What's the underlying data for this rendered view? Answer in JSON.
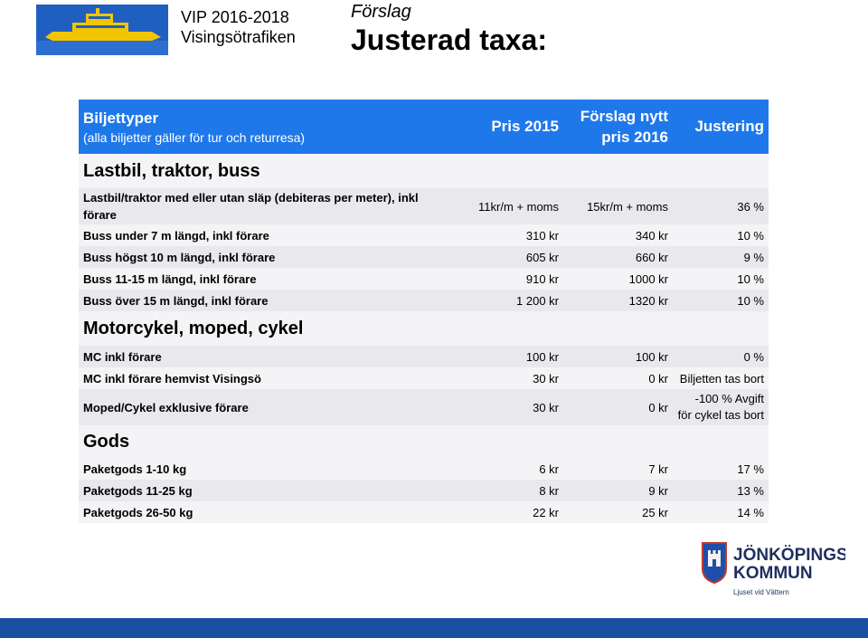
{
  "header": {
    "org_line1": "VIP 2016-2018",
    "org_line2": "Visingsötrafiken",
    "subtitle": "Förslag",
    "title": "Justerad taxa:"
  },
  "table": {
    "head": {
      "col1_title": "Biljettyper",
      "col1_sub": "(alla biljetter gäller för tur och returresa)",
      "col2": "Pris 2015",
      "col3_line1": "Förslag nytt",
      "col3_line2": "pris 2016",
      "col4": "Justering"
    },
    "sections": [
      {
        "title": "Lastbil, traktor, buss",
        "rows": [
          {
            "name": "Lastbil/traktor med eller utan släp (debiteras per meter), inkl förare",
            "p15": "11kr/m + moms",
            "p16": "15kr/m + moms",
            "adj": "36 %"
          },
          {
            "name": "Buss under 7 m längd, inkl förare",
            "p15": "310 kr",
            "p16": "340 kr",
            "adj": "10 %"
          },
          {
            "name": "Buss högst 10 m längd, inkl förare",
            "p15": "605 kr",
            "p16": "660 kr",
            "adj": "9 %"
          },
          {
            "name": "Buss 11-15 m längd, inkl förare",
            "p15": "910 kr",
            "p16": "1000 kr",
            "adj": "10 %"
          },
          {
            "name": "Buss över 15 m längd, inkl förare",
            "p15": "1 200 kr",
            "p16": "1320 kr",
            "adj": "10 %"
          }
        ]
      },
      {
        "title": "Motorcykel, moped, cykel",
        "rows": [
          {
            "name": "MC inkl förare",
            "p15": "100 kr",
            "p16": "100 kr",
            "adj": "0 %"
          },
          {
            "name": "MC inkl förare hemvist Visingsö",
            "p15": "30 kr",
            "p16": "0 kr",
            "adj": "Biljetten tas bort"
          },
          {
            "name": "Moped/Cykel exklusive förare",
            "p15": "30 kr",
            "p16": "0 kr",
            "adj_line1": "-100 % Avgift",
            "adj_line2": "för cykel tas bort"
          }
        ]
      },
      {
        "title": "Gods",
        "rows": [
          {
            "name": "Paketgods 1-10 kg",
            "p15": "6 kr",
            "p16": "7 kr",
            "adj": "17 %"
          },
          {
            "name": "Paketgods 11-25 kg",
            "p15": "8 kr",
            "p16": "9 kr",
            "adj": "13 %"
          },
          {
            "name": "Paketgods 26-50 kg",
            "p15": "22 kr",
            "p16": "25 kr",
            "adj": "14 %"
          }
        ]
      }
    ]
  },
  "footer": {
    "kommun_line1": "JÖNKÖPINGS",
    "kommun_line2": "KOMMUN",
    "kommun_tagline": "Ljuset vid Vättern"
  },
  "colors": {
    "header_blue": "#1f78ea",
    "logo_yellow": "#f2c500",
    "footer_blue": "#1b4fa0"
  },
  "icons": {
    "ferry_logo": "ferry-icon",
    "kommun_crest": "coat-of-arms-icon"
  }
}
